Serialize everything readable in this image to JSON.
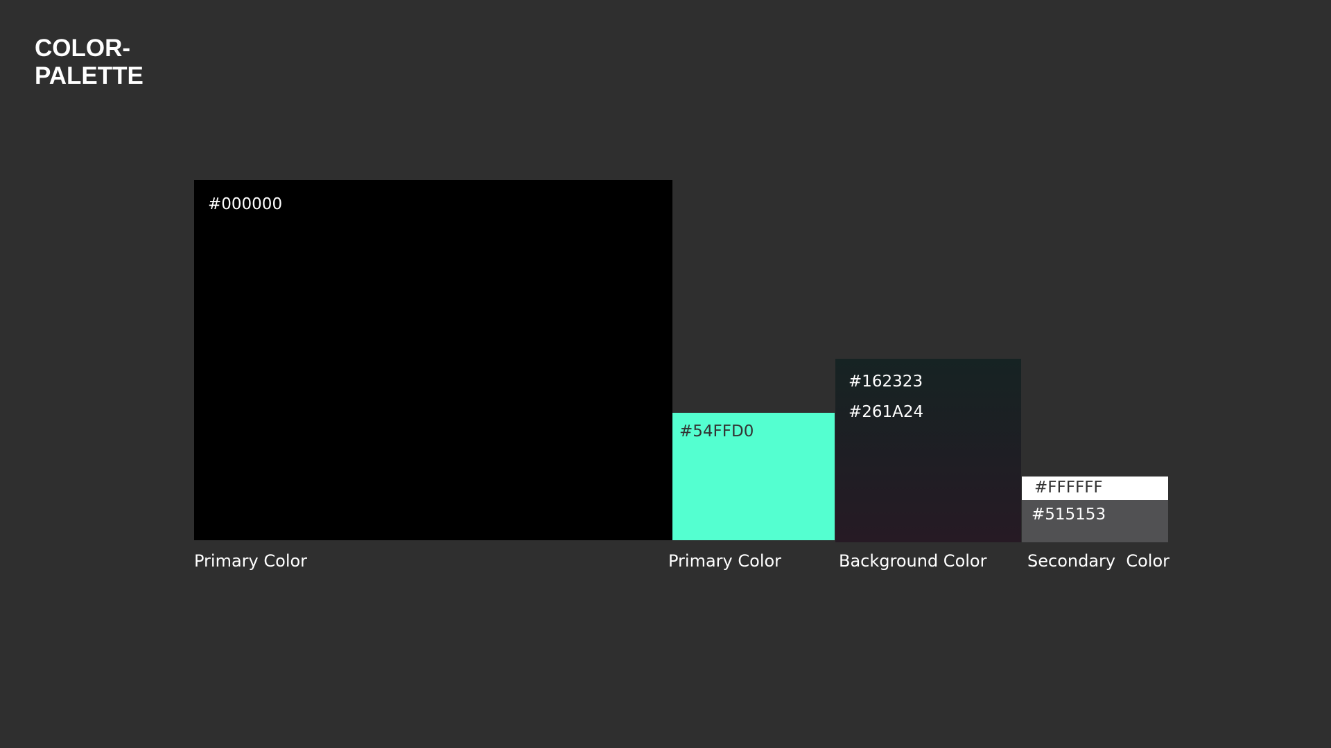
{
  "title": {
    "line1": "COLOR-",
    "line2": "PALETTE"
  },
  "swatches": [
    {
      "hex": "#000000",
      "label": "Primary Color",
      "color": "#000000",
      "text_color": "#ffffff"
    },
    {
      "hex": "#54FFD0",
      "label": "Primary Color",
      "color": "#54FFD0",
      "text_color": "#333333"
    },
    {
      "hex_top": "#162323",
      "hex_bottom": "#261A24",
      "label": "Background Color",
      "gradient_from": "#162323",
      "gradient_to": "#261A24",
      "text_color": "#ffffff"
    },
    {
      "hex_top": "#FFFFFF",
      "hex_bottom": "#515153",
      "label": "Secondary  Color",
      "top_color": "#FFFFFF",
      "bottom_color": "#515153",
      "top_text_color": "#333333",
      "bottom_text_color": "#ffffff"
    }
  ],
  "background_color": "#2f2f2f"
}
